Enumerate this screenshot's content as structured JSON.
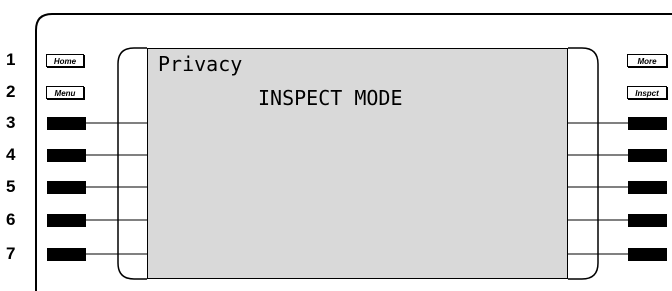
{
  "row_numbers": [
    "1",
    "2",
    "3",
    "4",
    "5",
    "6",
    "7"
  ],
  "left_labels": {
    "home": "Home",
    "menu": "Menu"
  },
  "right_labels": {
    "more": "More",
    "inspect": "Inspct"
  },
  "screen": {
    "title": "Privacy",
    "mode": "INSPECT MODE"
  },
  "colors": {
    "screen_bg": "#d9d9d9",
    "key": "#000000"
  }
}
